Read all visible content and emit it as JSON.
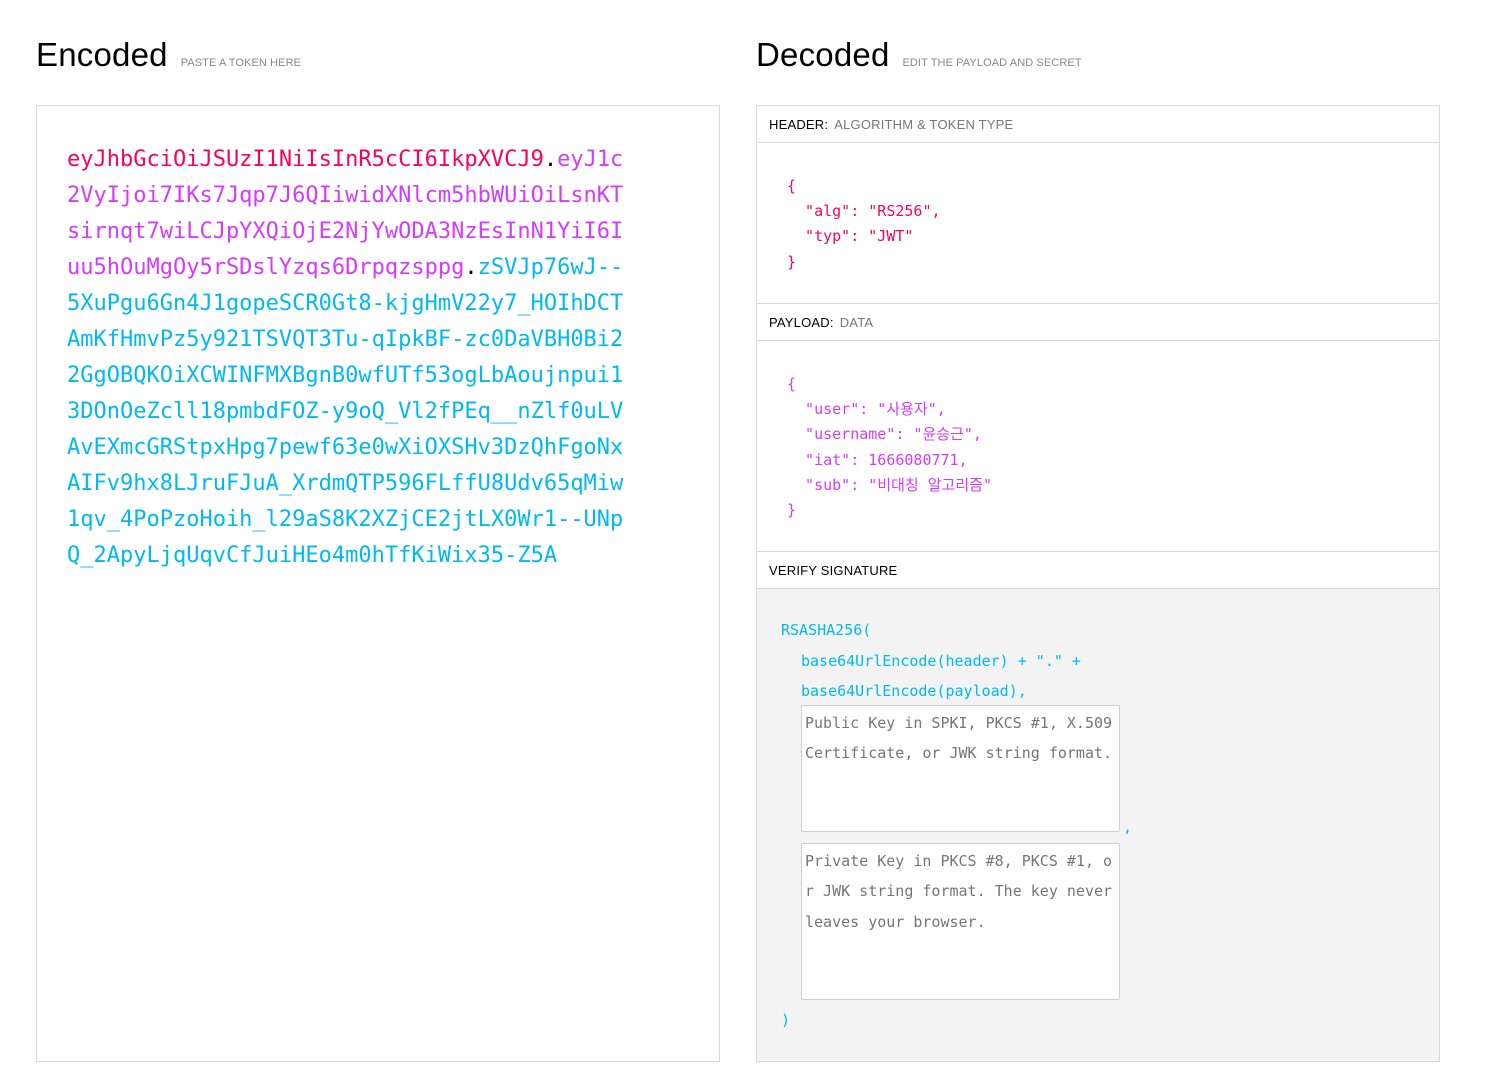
{
  "encoded": {
    "title": "Encoded",
    "subtitle": "PASTE A TOKEN HERE",
    "token": {
      "header": "eyJhbGciOiJSUzI1NiIsInR5cCI6IkpXVCJ9",
      "payload": "eyJ1c2VyIjoi7IKs7Jqp7J6QIiwidXNlcm5hbWUiOiLsnKTsirnqt7wiLCJpYXQiOjE2NjYwODA3NzEsInN1YiI6Iuu5hOuMgOy5rSDslYzqs6Drpqzsppg",
      "dot": ".",
      "signature": "zSVJp76wJ--5XuPgu6Gn4J1gopeSCR0Gt8-kjgHmV22y7_HOIhDCTAmKfHmvPz5y921TSVQT3Tu-qIpkBF-zc0DaVBH0Bi22GgOBQKOiXCWINFMXBgnB0wfUTf53ogLbAoujnpui13DOnOeZcll18pmbdFOZ-y9oQ_Vl2fPEq__nZlf0uLVAvEXmcGRStpxHpg7pewf63e0wXiOXSHv3DzQhFgoNxAIFv9hx8LJruFJuA_XrdmQTP596FLffU8Udv65qMiw1qv_4PoPzoHoih_l29aS8K2XZjCE2jtLX0Wr1--UNpQ_2ApyLjqUqvCfJuiHEo4m0hTfKiWix35-Z5A"
    }
  },
  "decoded": {
    "title": "Decoded",
    "subtitle": "EDIT THE PAYLOAD AND SECRET",
    "header": {
      "label": "HEADER:",
      "desc": "ALGORITHM & TOKEN TYPE",
      "json": "{\n  \"alg\": \"RS256\",\n  \"typ\": \"JWT\"\n}"
    },
    "payload": {
      "label": "PAYLOAD:",
      "desc": "DATA",
      "json": "{\n  \"user\": \"사용자\",\n  \"username\": \"윤승근\",\n  \"iat\": 1666080771,\n  \"sub\": \"비대칭 알고리즘\"\n}"
    },
    "signature": {
      "label": "VERIFY SIGNATURE",
      "line1": "RSASHA256(",
      "line2": "base64UrlEncode(header) + \".\" +",
      "line3": "base64UrlEncode(payload),",
      "public_key_placeholder": "Public Key in SPKI, PKCS #1, X.509 Certificate, or JWK string format.",
      "comma": ",",
      "private_key_placeholder": "Private Key in PKCS #8, PKCS #1, or JWK string format. The key never leaves your browser.",
      "close": ")"
    }
  },
  "colors": {
    "header": "#fb015b",
    "payload": "#d63aff",
    "signature": "#00b9f1"
  }
}
